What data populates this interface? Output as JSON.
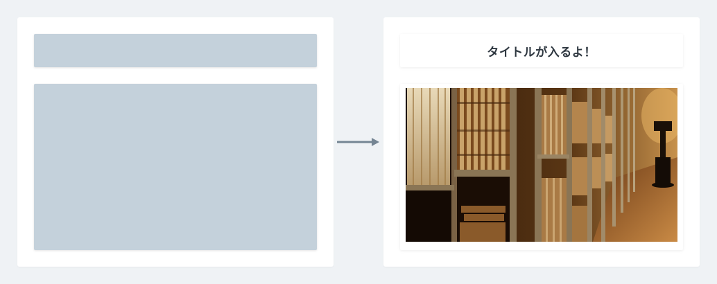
{
  "right_card": {
    "title": "タイトルが入るよ！",
    "image_description": "library-bookshelves-photo"
  },
  "arrow_icon": "right-arrow-icon",
  "colors": {
    "background": "#eff2f5",
    "card": "#ffffff",
    "placeholder": "#c4d1db",
    "arrow": "#758593",
    "title_text": "#2e3740"
  }
}
